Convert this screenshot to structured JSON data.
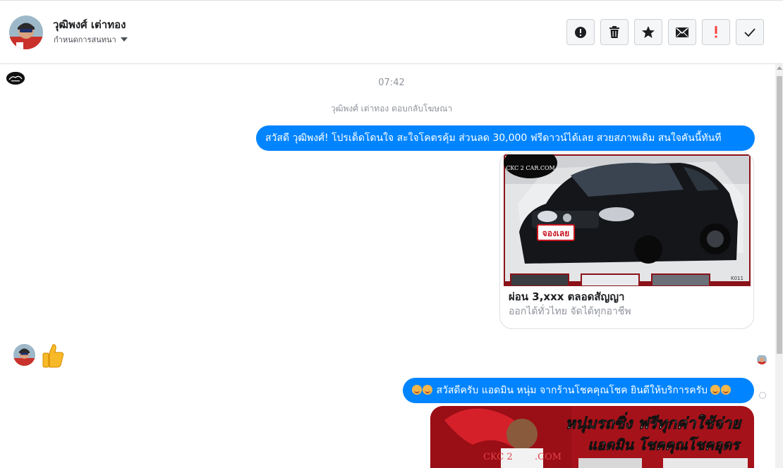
{
  "header": {
    "contact_name": "วุฒิพงศ์ เต่าทอง",
    "assign_label": "กำหนดการสนทนา",
    "actions": [
      {
        "name": "mark-spam-button",
        "icon": "alert-circle-icon"
      },
      {
        "name": "delete-button",
        "icon": "trash-icon"
      },
      {
        "name": "star-button",
        "icon": "star-icon"
      },
      {
        "name": "mark-unread-button",
        "icon": "envelope-icon"
      },
      {
        "name": "follow-up-button",
        "icon": "exclamation-icon"
      },
      {
        "name": "mark-done-button",
        "icon": "check-icon"
      }
    ]
  },
  "conversation": {
    "timestamp": "07:42",
    "system_message": "วุฒิพงศ์ เต่าทอง ตอบกลับโฆษณา",
    "message_1": "สวัสดี วุฒิพงศ์! โปรเด็ดโดนใจ สะใจโคตรคุ้ม ส่วนลด 30,000 ฟรีดาวน์ได้เลย สวยสภาพเดิม สนใจคันนี้ทันที",
    "card": {
      "image_watermark": "CKC 2 CAR.COM",
      "image_badge": "จองเลย",
      "image_code": "K011",
      "title": "ผ่อน 3,xxx ตลอดสัญญา",
      "subtitle": "ออกได้ทั่วไทย จัดได้ทุกอาชีพ"
    },
    "reply_emoji": "thumbs-up-icon",
    "message_2": "สวัสดีครับ แอดมิน หนุ่ม จากร้านโชคคุณโชค ยินดีให้บริการครับ",
    "banner": {
      "line_1": "หนุ่มรถซิ่ง ฟรีทุกค่าใช้จ่าย",
      "line_2": "แอดมิน โชคคุณโชคอุดร",
      "logo_text": "CKC 2 CAR.COM"
    }
  },
  "colors": {
    "accent": "#0084ff",
    "follow_up": "#fa3e3e",
    "banner_red": "#c8141e"
  }
}
